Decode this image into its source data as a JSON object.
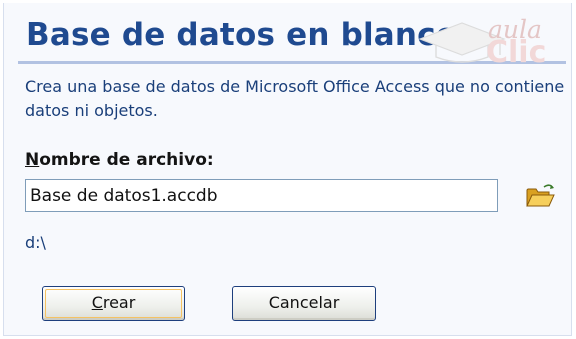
{
  "dialog": {
    "title": "Base de datos en blanco",
    "description": "Crea una base de datos de Microsoft Office Access que no contiene datos ni objetos.",
    "filename_label_first": "N",
    "filename_label_rest": "ombre de archivo:",
    "filename_value": "Base de datos1.accdb",
    "path": "d:\\",
    "browse_icon": "open-folder-icon"
  },
  "buttons": {
    "create_first": "C",
    "create_rest": "rear",
    "cancel": "Cancelar"
  },
  "watermark": {
    "line1": "aula",
    "line2": "Clic"
  },
  "colors": {
    "title": "#1f4a90",
    "panel_bg": "#f7f9fd",
    "rule": "#b2c2e2",
    "text_blue": "#1a3f7a"
  }
}
